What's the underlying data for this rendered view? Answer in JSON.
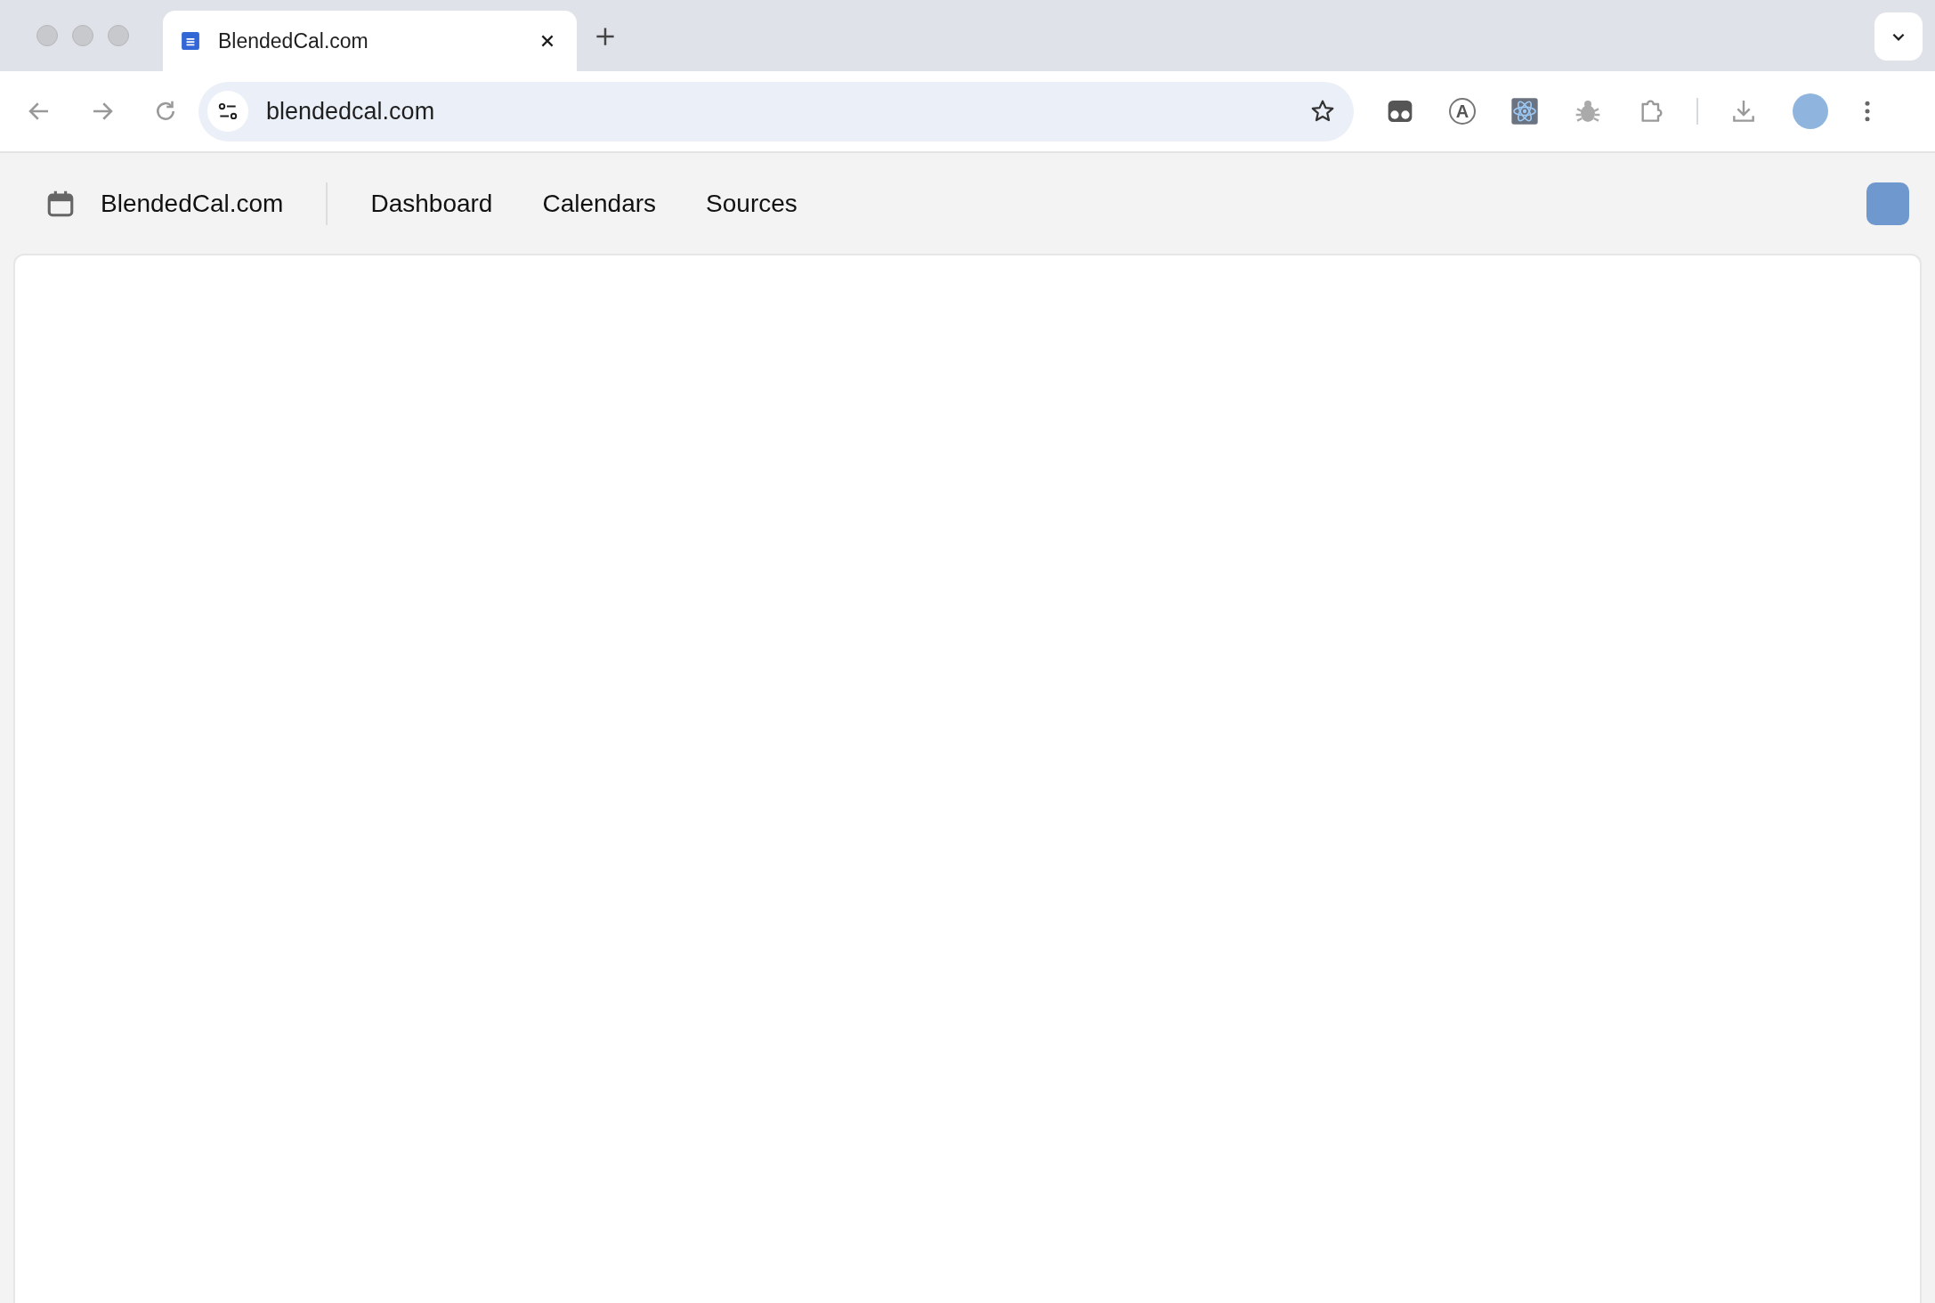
{
  "browser": {
    "tab": {
      "title": "BlendedCal.com"
    },
    "address": "blendedcal.com",
    "extension_letter": "A"
  },
  "app": {
    "brand": "BlendedCal.com",
    "nav": [
      {
        "label": "Dashboard"
      },
      {
        "label": "Calendars"
      },
      {
        "label": "Sources"
      }
    ]
  }
}
